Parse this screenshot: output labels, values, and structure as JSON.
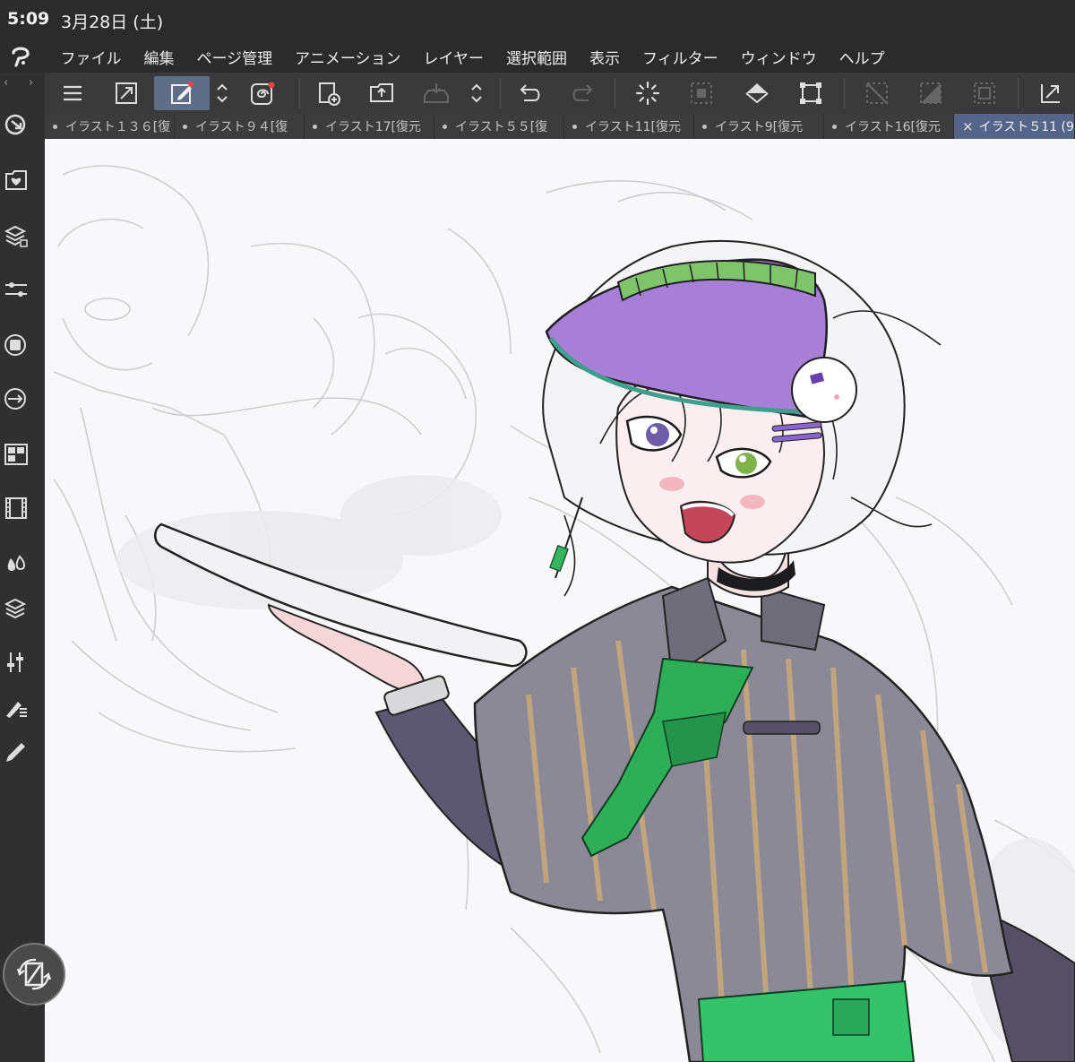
{
  "status_bar": {
    "time": "5:09",
    "date": "3月28日 (土)"
  },
  "menu": {
    "items": [
      "ファイル",
      "編集",
      "ページ管理",
      "アニメーション",
      "レイヤー",
      "選択範囲",
      "表示",
      "フィルター",
      "ウィンドウ",
      "ヘルプ"
    ]
  },
  "toolbar_icons": [
    "menu-icon",
    "fullscreen-icon",
    "edit-icon",
    "chevron-updown-icon",
    "spiral-icon",
    "new-page-icon",
    "open-folder-icon",
    "save-icon",
    "chevron-updown-icon",
    "undo-icon",
    "redo-icon",
    "loading-icon",
    "select-icon",
    "fill-icon",
    "transform-icon",
    "deselect-icon",
    "invert-selection-icon",
    "border-selection-icon",
    "arrow-icon"
  ],
  "left_tools": [
    "quick-access-icon",
    "material-icon",
    "layer-property-icon",
    "sub-tool-detail-icon",
    "color-circle-icon",
    "navigator-icon",
    "layer-search-icon",
    "timeline-icon",
    "color-set-icon",
    "layers-icon",
    "adjust-icon",
    "sub-tool-icon",
    "pen-icon"
  ],
  "tabs": [
    {
      "label": "イラスト１３６[復"
    },
    {
      "label": "イラスト９４[復"
    },
    {
      "label": "イラスト17[復元"
    },
    {
      "label": "イラスト５５[復"
    },
    {
      "label": "イラスト11[復元"
    },
    {
      "label": "イラスト9[復元"
    },
    {
      "label": "イラスト16[復元"
    },
    {
      "label": "イラスト５11 (9"
    }
  ],
  "colors": {
    "accent_active": "#5f6d86",
    "tab_active": "#55658a",
    "visor_purple": "#a77fd6",
    "tie_green": "#2fae5a",
    "shirt_gray": "#8b8996"
  }
}
